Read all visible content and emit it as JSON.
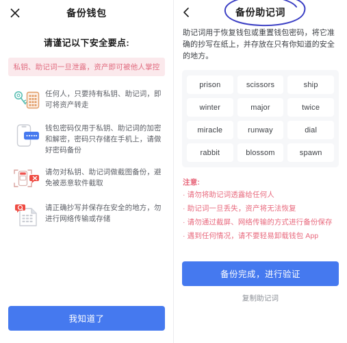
{
  "colors": {
    "accent_blue": "#4579ef",
    "warning_pink_text": "#e8697d",
    "warning_pink_bg": "#fbe9ec",
    "panel_gray": "#f6f7f9",
    "ink_annotation": "#3b3fc4"
  },
  "left_screen": {
    "nav": {
      "close_icon": "close-icon",
      "title": "备份钱包"
    },
    "lead_title": "请谨记以下安全要点:",
    "banner": "私钥、助记词一旦泄露，资产即可被他人掌控",
    "tips": [
      {
        "icon": "key-and-keypad-icon",
        "text": "任何人，只要持有私钥、助记词，即可将资产转走"
      },
      {
        "icon": "phone-password-icon",
        "text": "钱包密码仅用于私钥、助记词的加密和解密，密码只存储在手机上，请做好密码备份"
      },
      {
        "icon": "no-screenshot-icon",
        "text": "请勿对私钥、助记词做截图备份，避免被恶意软件截取"
      },
      {
        "icon": "document-alert-icon",
        "text": "请正确抄写并保存在安全的地方，勿进行网络传输或存储"
      }
    ],
    "primary_button": "我知道了"
  },
  "right_screen": {
    "nav": {
      "back_icon": "chevron-left-icon",
      "title": "备份助记词",
      "annotation": "hand-drawn-blue-circle"
    },
    "description": "助记词用于恢复钱包或重置钱包密码，将它准确的抄写在纸上，并存放在只有你知道的安全的地方。",
    "mnemonic_words": [
      "prison",
      "scissors",
      "ship",
      "winter",
      "major",
      "twice",
      "miracle",
      "runway",
      "dial",
      "rabbit",
      "blossom",
      "spawn"
    ],
    "notes_title": "注意:",
    "notes": [
      "· 请勿将助记词透露给任何人",
      "· 助记词一旦丢失，资产将无法恢复",
      "· 请勿通过截屏、网络传输的方式进行备份保存",
      "· 遇到任何情况，请不要轻易卸载钱包 App"
    ],
    "primary_button": "备份完成，进行验证",
    "secondary_link": "复制助记词"
  }
}
